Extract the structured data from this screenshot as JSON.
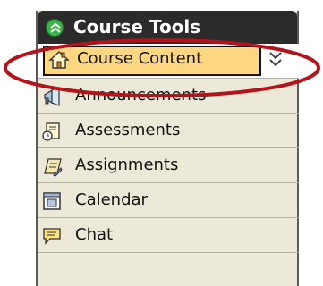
{
  "panel": {
    "title": "Course Tools",
    "header_icon": "collapse-toggle-icon",
    "items": [
      {
        "label": "Course Content",
        "icon": "home-icon",
        "selected": true
      },
      {
        "label": "Announcements",
        "icon": "megaphone-icon"
      },
      {
        "label": "Assessments",
        "icon": "quiz-icon"
      },
      {
        "label": "Assignments",
        "icon": "assignment-icon"
      },
      {
        "label": "Calendar",
        "icon": "calendar-icon"
      },
      {
        "label": "Chat",
        "icon": "chat-icon"
      }
    ],
    "expand_icon": "double-chevron-down-icon"
  },
  "colors": {
    "header_bg": "#2b2b2b",
    "panel_bg": "#ece9d8",
    "selected_bg": "#ffd780",
    "toggle_green": "#3bb54a",
    "annotation_red": "#b3141b"
  }
}
